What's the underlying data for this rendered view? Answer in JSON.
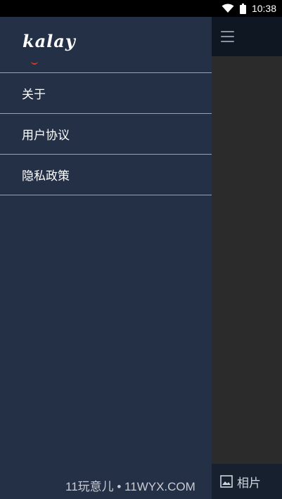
{
  "status_bar": {
    "time": "10:38",
    "icons": [
      "wifi-icon",
      "battery-icon"
    ]
  },
  "drawer": {
    "logo_text": "kalay",
    "items": [
      {
        "label": "关于"
      },
      {
        "label": "用户协议"
      },
      {
        "label": "隐私政策"
      }
    ]
  },
  "bottom_bar": {
    "photos_label": "相片",
    "photos_icon": "image-icon"
  },
  "watermark": {
    "text": "11玩意儿 • 11WYX.COM"
  },
  "colors": {
    "drawer_bg": "#243046",
    "header_bg": "#0f1722",
    "content_bg": "#2b2b2b",
    "bottom_bar_bg": "#16202f",
    "logo_accent": "#d0402a"
  }
}
